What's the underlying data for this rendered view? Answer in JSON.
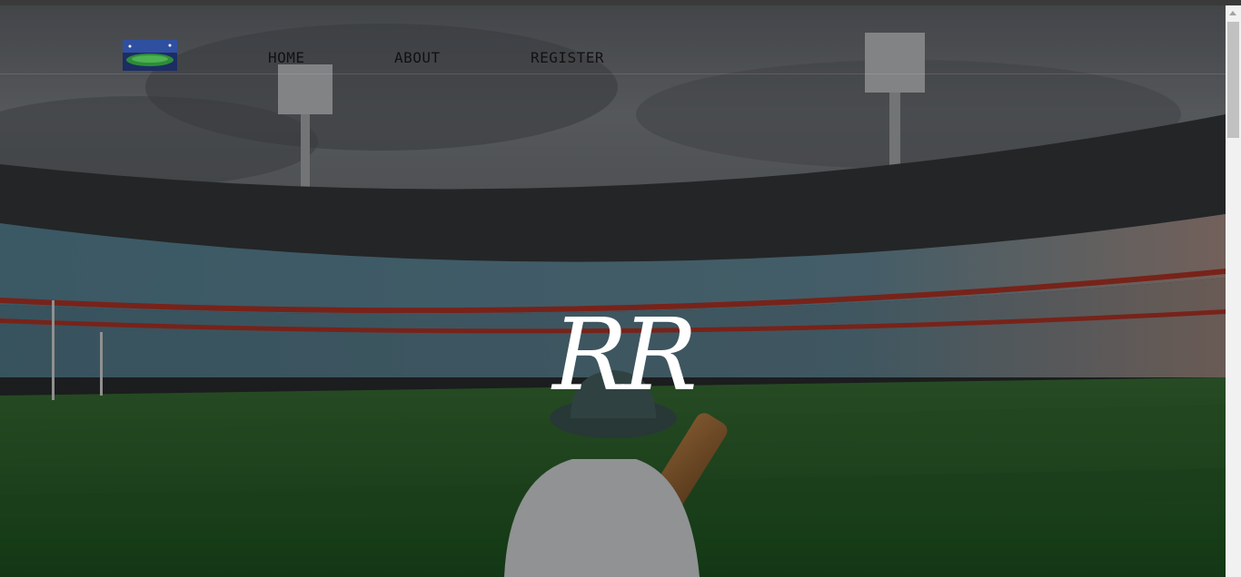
{
  "nav": {
    "items": [
      {
        "label": "HOME"
      },
      {
        "label": "ABOUT"
      },
      {
        "label": "REGISTER"
      }
    ]
  },
  "hero": {
    "brand": "RR"
  },
  "icons": {
    "logo": "stadium-thumbnail-icon",
    "brand": "rr-script-logo"
  },
  "colors": {
    "nav_text": "#111111",
    "overlay": "#000000",
    "brand_text": "#ffffff"
  }
}
